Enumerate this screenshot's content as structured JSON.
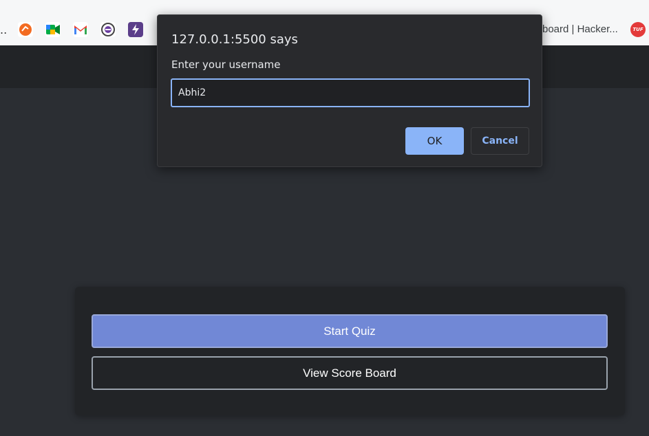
{
  "bookmarks_bar": {
    "leading_ellipsis": "..",
    "icons": [
      {
        "name": "orange-bookmark-icon",
        "color": "#f36b21",
        "glyph": "◔"
      },
      {
        "name": "google-meet-icon",
        "color": "#00897b",
        "glyph": "▶"
      },
      {
        "name": "gmail-icon",
        "color": "#ea4335",
        "glyph": "M"
      },
      {
        "name": "circle-bookmark-icon",
        "color": "#6b3fa0",
        "glyph": "◎"
      },
      {
        "name": "lightning-bookmark-icon",
        "color": "#5b3e8a",
        "glyph": "⚡"
      }
    ],
    "truncated_label": "board | Hacker...",
    "tuf_label": "TUF"
  },
  "dialog": {
    "title": "127.0.0.1:5500 says",
    "message": "Enter your username",
    "input_value": "Abhi2",
    "ok_label": "OK",
    "cancel_label": "Cancel"
  },
  "menu": {
    "start_label": "Start Quiz",
    "scoreboard_label": "View Score Board"
  },
  "colors": {
    "page_background": "#2b2e33",
    "accent": "#7188d6",
    "dialog_accent": "#8ab4f8"
  }
}
